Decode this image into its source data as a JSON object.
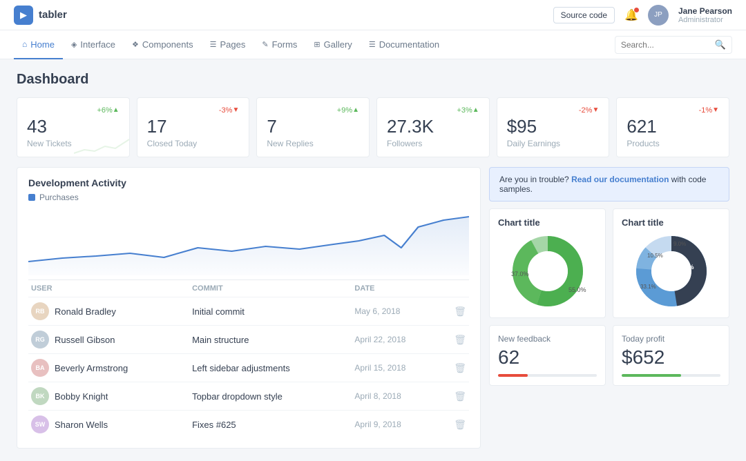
{
  "brand": {
    "logo_text": "tabler",
    "logo_icon": "▶"
  },
  "header": {
    "source_btn": "Source code",
    "user": {
      "name": "Jane Pearson",
      "role": "Administrator",
      "initials": "JP"
    }
  },
  "main_nav": {
    "links": [
      {
        "label": "Home",
        "icon": "⌂",
        "active": true
      },
      {
        "label": "Interface",
        "icon": "◈",
        "active": false
      },
      {
        "label": "Components",
        "icon": "❖",
        "active": false
      },
      {
        "label": "Pages",
        "icon": "☰",
        "active": false
      },
      {
        "label": "Forms",
        "icon": "✎",
        "active": false
      },
      {
        "label": "Gallery",
        "icon": "⊞",
        "active": false
      },
      {
        "label": "Documentation",
        "icon": "☰",
        "active": false
      }
    ],
    "search_placeholder": "Search..."
  },
  "page": {
    "title": "Dashboard"
  },
  "stat_cards": [
    {
      "value": "43",
      "label": "New Tickets",
      "badge": "+6%",
      "badge_type": "green"
    },
    {
      "value": "17",
      "label": "Closed Today",
      "badge": "-3%",
      "badge_type": "red"
    },
    {
      "value": "7",
      "label": "New Replies",
      "badge": "+9%",
      "badge_type": "green"
    },
    {
      "value": "27.3K",
      "label": "Followers",
      "badge": "+3%",
      "badge_type": "green"
    },
    {
      "value": "$95",
      "label": "Daily Earnings",
      "badge": "-2%",
      "badge_type": "red"
    },
    {
      "value": "621",
      "label": "Products",
      "badge": "-1%",
      "badge_type": "red"
    }
  ],
  "dev_activity": {
    "title": "Development Activity",
    "legend_label": "Purchases",
    "commits": [
      {
        "user": "Ronald Bradley",
        "initials": "RB",
        "avatar_class": "ua1",
        "commit": "Initial commit",
        "date": "May 6, 2018"
      },
      {
        "user": "Russell Gibson",
        "initials": "RG",
        "avatar_class": "ua2",
        "commit": "Main structure",
        "date": "April 22, 2018"
      },
      {
        "user": "Beverly Armstrong",
        "initials": "BA",
        "avatar_class": "ua3",
        "commit": "Left sidebar adjustments",
        "date": "April 15, 2018"
      },
      {
        "user": "Bobby Knight",
        "initials": "BK",
        "avatar_class": "ua4",
        "commit": "Topbar dropdown style",
        "date": "April 8, 2018"
      },
      {
        "user": "Sharon Wells",
        "initials": "SW",
        "avatar_class": "ua5",
        "commit": "Fixes #625",
        "date": "April 9, 2018"
      }
    ],
    "table_headers": [
      "USER",
      "COMMIT",
      "DATE",
      ""
    ]
  },
  "right_panel": {
    "alert_text": "Are you in trouble?",
    "alert_link": "Read our documentation",
    "alert_suffix": "with code samples.",
    "chart1": {
      "title": "Chart title",
      "slices": [
        {
          "label": "37.0%",
          "value": 37.0,
          "color": "#5cb85c"
        },
        {
          "label": "55.0%",
          "value": 55.0,
          "color": "#4CAF50"
        },
        {
          "label": "8.0%",
          "value": 8.0,
          "color": "#a5d6a7"
        }
      ]
    },
    "chart2": {
      "title": "Chart title",
      "slices": [
        {
          "label": "47.4%",
          "value": 47.4,
          "color": "#354052"
        },
        {
          "label": "33.1%",
          "value": 33.1,
          "color": "#5b9bd5"
        },
        {
          "label": "10.5%",
          "value": 10.5,
          "color": "#7fb3e0"
        },
        {
          "label": "9.0%",
          "value": 9.0,
          "color": "#c5daf0"
        }
      ]
    },
    "feedback": {
      "label": "New feedback",
      "value": "62",
      "progress": 30,
      "progress_color": "fill-red"
    },
    "profit": {
      "label": "Today profit",
      "value": "$652",
      "progress": 60,
      "progress_color": "fill-green"
    }
  }
}
